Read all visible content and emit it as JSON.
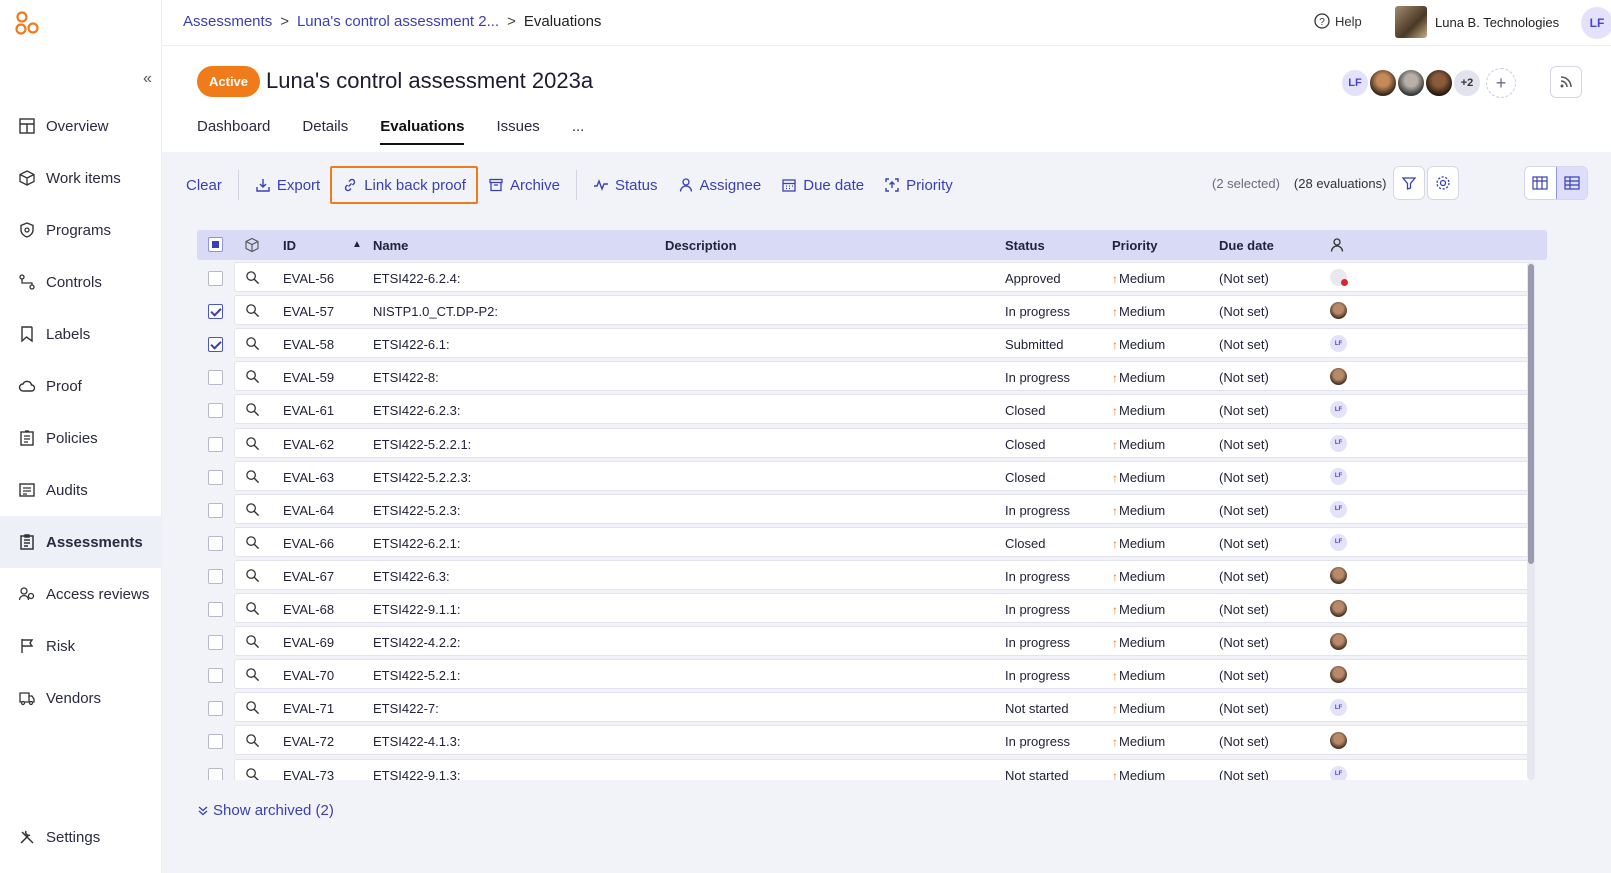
{
  "sidebar": {
    "items": [
      {
        "label": "Overview",
        "icon": "overview-icon"
      },
      {
        "label": "Work items",
        "icon": "box-icon"
      },
      {
        "label": "Programs",
        "icon": "shield-icon"
      },
      {
        "label": "Controls",
        "icon": "controls-icon"
      },
      {
        "label": "Labels",
        "icon": "label-icon"
      },
      {
        "label": "Proof",
        "icon": "cloud-icon"
      },
      {
        "label": "Policies",
        "icon": "policies-icon"
      },
      {
        "label": "Audits",
        "icon": "audits-icon"
      },
      {
        "label": "Assessments",
        "icon": "clipboard-icon",
        "active": true
      },
      {
        "label": "Access reviews",
        "icon": "access-icon"
      },
      {
        "label": "Risk",
        "icon": "flag-icon"
      },
      {
        "label": "Vendors",
        "icon": "truck-icon"
      }
    ],
    "settings_label": "Settings"
  },
  "topbar": {
    "breadcrumb": [
      "Assessments",
      "Luna's control assessment 2...",
      "Evaluations"
    ],
    "help_label": "Help",
    "org_name": "Luna B. Technologies",
    "user_initials": "LF"
  },
  "header": {
    "status_badge": "Active",
    "title": "Luna's control assessment 2023a",
    "member_initials": "LF",
    "more_members": "+2",
    "add_member": "+",
    "tabs": [
      "Dashboard",
      "Details",
      "Evaluations",
      "Issues",
      "..."
    ],
    "active_tab": "Evaluations"
  },
  "toolbar": {
    "clear": "Clear",
    "export": "Export",
    "link_back_proof": "Link back proof",
    "archive": "Archive",
    "status": "Status",
    "assignee": "Assignee",
    "due_date": "Due date",
    "priority": "Priority",
    "selected_count": "(2 selected)",
    "evaluation_count": "(28 evaluations)"
  },
  "table": {
    "columns": {
      "id": "ID",
      "name": "Name",
      "description": "Description",
      "status": "Status",
      "priority": "Priority",
      "due_date": "Due date"
    },
    "rows": [
      {
        "id": "EVAL-56",
        "name": "ETSI422-6.2.4:",
        "status": "Approved",
        "priority": "Medium",
        "due": "(Not set)",
        "checked": false,
        "assignee": "blocked"
      },
      {
        "id": "EVAL-57",
        "name": "NISTP1.0_CT.DP-P2:",
        "status": "In progress",
        "priority": "Medium",
        "due": "(Not set)",
        "checked": true,
        "assignee": "photo"
      },
      {
        "id": "EVAL-58",
        "name": "ETSI422-6.1:",
        "status": "Submitted",
        "priority": "Medium",
        "due": "(Not set)",
        "checked": true,
        "assignee": "lf"
      },
      {
        "id": "EVAL-59",
        "name": "ETSI422-8:",
        "status": "In progress",
        "priority": "Medium",
        "due": "(Not set)",
        "checked": false,
        "assignee": "photo"
      },
      {
        "id": "EVAL-61",
        "name": "ETSI422-6.2.3:",
        "status": "Closed",
        "priority": "Medium",
        "due": "(Not set)",
        "checked": false,
        "assignee": "lf"
      },
      {
        "id": "EVAL-62",
        "name": "ETSI422-5.2.2.1:",
        "status": "Closed",
        "priority": "Medium",
        "due": "(Not set)",
        "checked": false,
        "assignee": "lf"
      },
      {
        "id": "EVAL-63",
        "name": "ETSI422-5.2.2.3:",
        "status": "Closed",
        "priority": "Medium",
        "due": "(Not set)",
        "checked": false,
        "assignee": "lf"
      },
      {
        "id": "EVAL-64",
        "name": "ETSI422-5.2.3:",
        "status": "In progress",
        "priority": "Medium",
        "due": "(Not set)",
        "checked": false,
        "assignee": "lf"
      },
      {
        "id": "EVAL-66",
        "name": "ETSI422-6.2.1:",
        "status": "Closed",
        "priority": "Medium",
        "due": "(Not set)",
        "checked": false,
        "assignee": "lf"
      },
      {
        "id": "EVAL-67",
        "name": "ETSI422-6.3:",
        "status": "In progress",
        "priority": "Medium",
        "due": "(Not set)",
        "checked": false,
        "assignee": "photo"
      },
      {
        "id": "EVAL-68",
        "name": "ETSI422-9.1.1:",
        "status": "In progress",
        "priority": "Medium",
        "due": "(Not set)",
        "checked": false,
        "assignee": "photo"
      },
      {
        "id": "EVAL-69",
        "name": "ETSI422-4.2.2:",
        "status": "In progress",
        "priority": "Medium",
        "due": "(Not set)",
        "checked": false,
        "assignee": "photo"
      },
      {
        "id": "EVAL-70",
        "name": "ETSI422-5.2.1:",
        "status": "In progress",
        "priority": "Medium",
        "due": "(Not set)",
        "checked": false,
        "assignee": "photo"
      },
      {
        "id": "EVAL-71",
        "name": "ETSI422-7:",
        "status": "Not started",
        "priority": "Medium",
        "due": "(Not set)",
        "checked": false,
        "assignee": "lf"
      },
      {
        "id": "EVAL-72",
        "name": "ETSI422-4.1.3:",
        "status": "In progress",
        "priority": "Medium",
        "due": "(Not set)",
        "checked": false,
        "assignee": "photo"
      },
      {
        "id": "EVAL-73",
        "name": "ETSI422-9.1.3:",
        "status": "Not started",
        "priority": "Medium",
        "due": "(Not set)",
        "checked": false,
        "assignee": "lf"
      }
    ]
  },
  "footer": {
    "show_archived": "Show archived (2)"
  },
  "colors": {
    "accent": "#3a3fb5",
    "active_badge": "#f07b1a",
    "highlight_border": "#f07b1a",
    "header_row": "#d8daf6"
  }
}
